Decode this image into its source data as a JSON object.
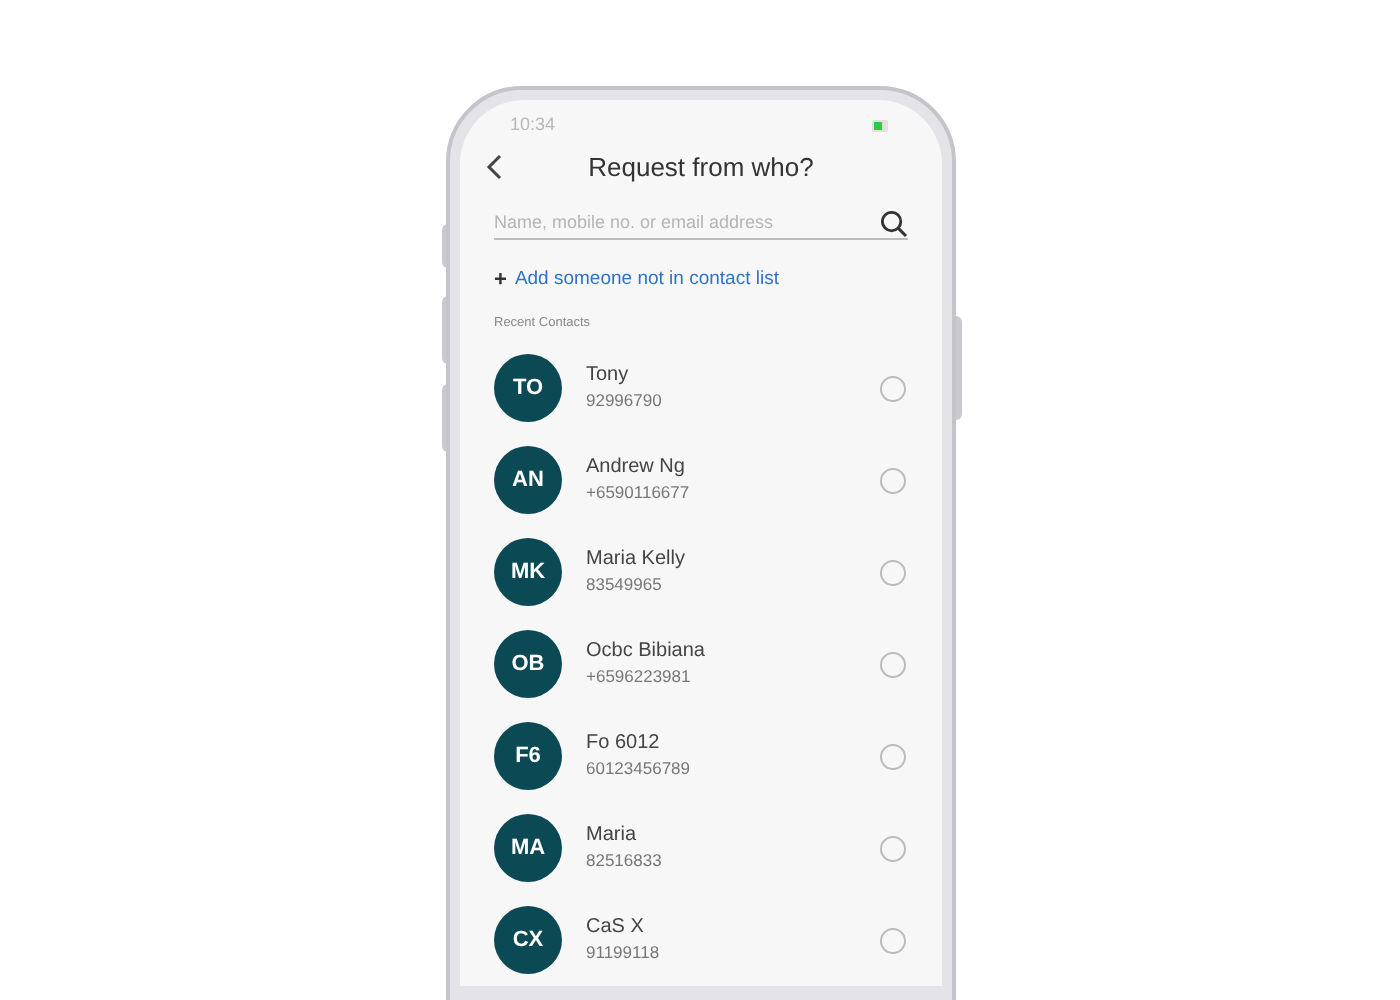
{
  "status_bar": {
    "time": "10:34"
  },
  "header": {
    "title": "Request from who?"
  },
  "search": {
    "placeholder": "Name, mobile no. or email address"
  },
  "add_link": {
    "icon": "+",
    "label": "Add someone not in contact list"
  },
  "section_title": "Recent Contacts",
  "contacts": [
    {
      "initials": "TO",
      "name": "Tony",
      "phone": "92996790",
      "selected": false
    },
    {
      "initials": "AN",
      "name": "Andrew Ng",
      "phone": "+6590116677",
      "selected": false
    },
    {
      "initials": "MK",
      "name": "Maria Kelly",
      "phone": "83549965",
      "selected": false
    },
    {
      "initials": "OB",
      "name": "Ocbc Bibiana",
      "phone": "+6596223981",
      "selected": false
    },
    {
      "initials": "F6",
      "name": "Fo 6012",
      "phone": "60123456789",
      "selected": false
    },
    {
      "initials": "MA",
      "name": "Maria",
      "phone": "82516833",
      "selected": false
    },
    {
      "initials": "CX",
      "name": "CaS X",
      "phone": "91199118",
      "selected": false
    }
  ]
}
